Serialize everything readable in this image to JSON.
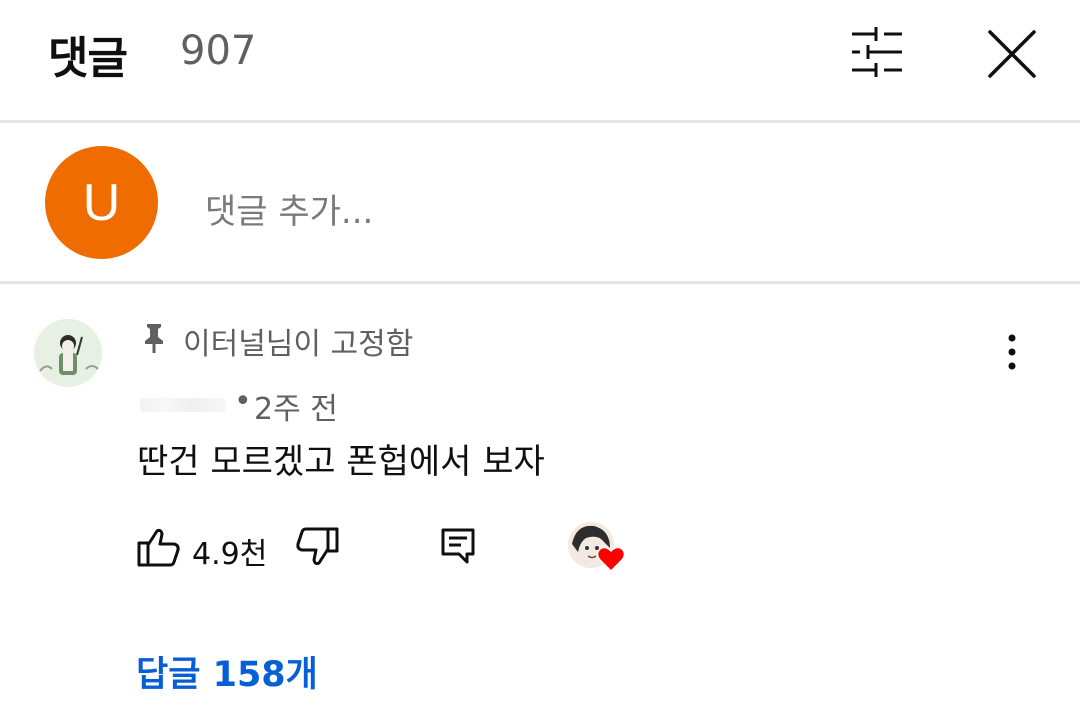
{
  "header": {
    "title": "댓글",
    "count": "907"
  },
  "add_comment": {
    "avatar_letter": "U",
    "placeholder": "댓글 추가..."
  },
  "comment": {
    "pinned_label": "이터널님이 고정함",
    "separator": "•",
    "time": "2주 전",
    "text": "딴건 모르겠고 폰헙에서 보자",
    "like_count": "4.9천",
    "replies_label": "답글 158개"
  },
  "icons": {
    "filter": "sliders-icon",
    "close": "close-icon",
    "pin": "pin-icon",
    "more": "more-vert-icon",
    "like": "thumb-up-icon",
    "dislike": "thumb-down-icon",
    "reply": "comment-icon",
    "creator_heart": "heart-icon"
  },
  "colors": {
    "avatar_bg": "#ef6c00",
    "link_blue": "#065fd4",
    "heart_red": "#ff0000",
    "secondary_text": "#606060",
    "divider": "#e5e5e5"
  }
}
